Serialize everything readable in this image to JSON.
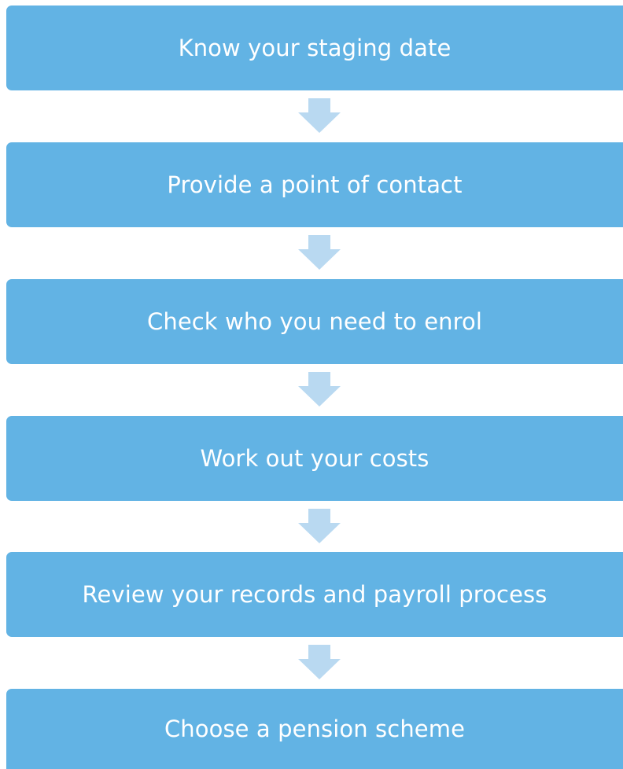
{
  "flowchart": {
    "steps": [
      {
        "label": "Know your staging date"
      },
      {
        "label": "Provide a point of contact"
      },
      {
        "label": "Check who you need to enrol"
      },
      {
        "label": "Work out your costs"
      },
      {
        "label": "Review your records and payroll process"
      },
      {
        "label": "Choose a pension scheme"
      }
    ],
    "colors": {
      "step_fill": "#62b3e4",
      "step_text": "#ffffff",
      "arrow_fill": "#b9d9f1"
    },
    "connector_icon": "down-arrow-icon"
  }
}
